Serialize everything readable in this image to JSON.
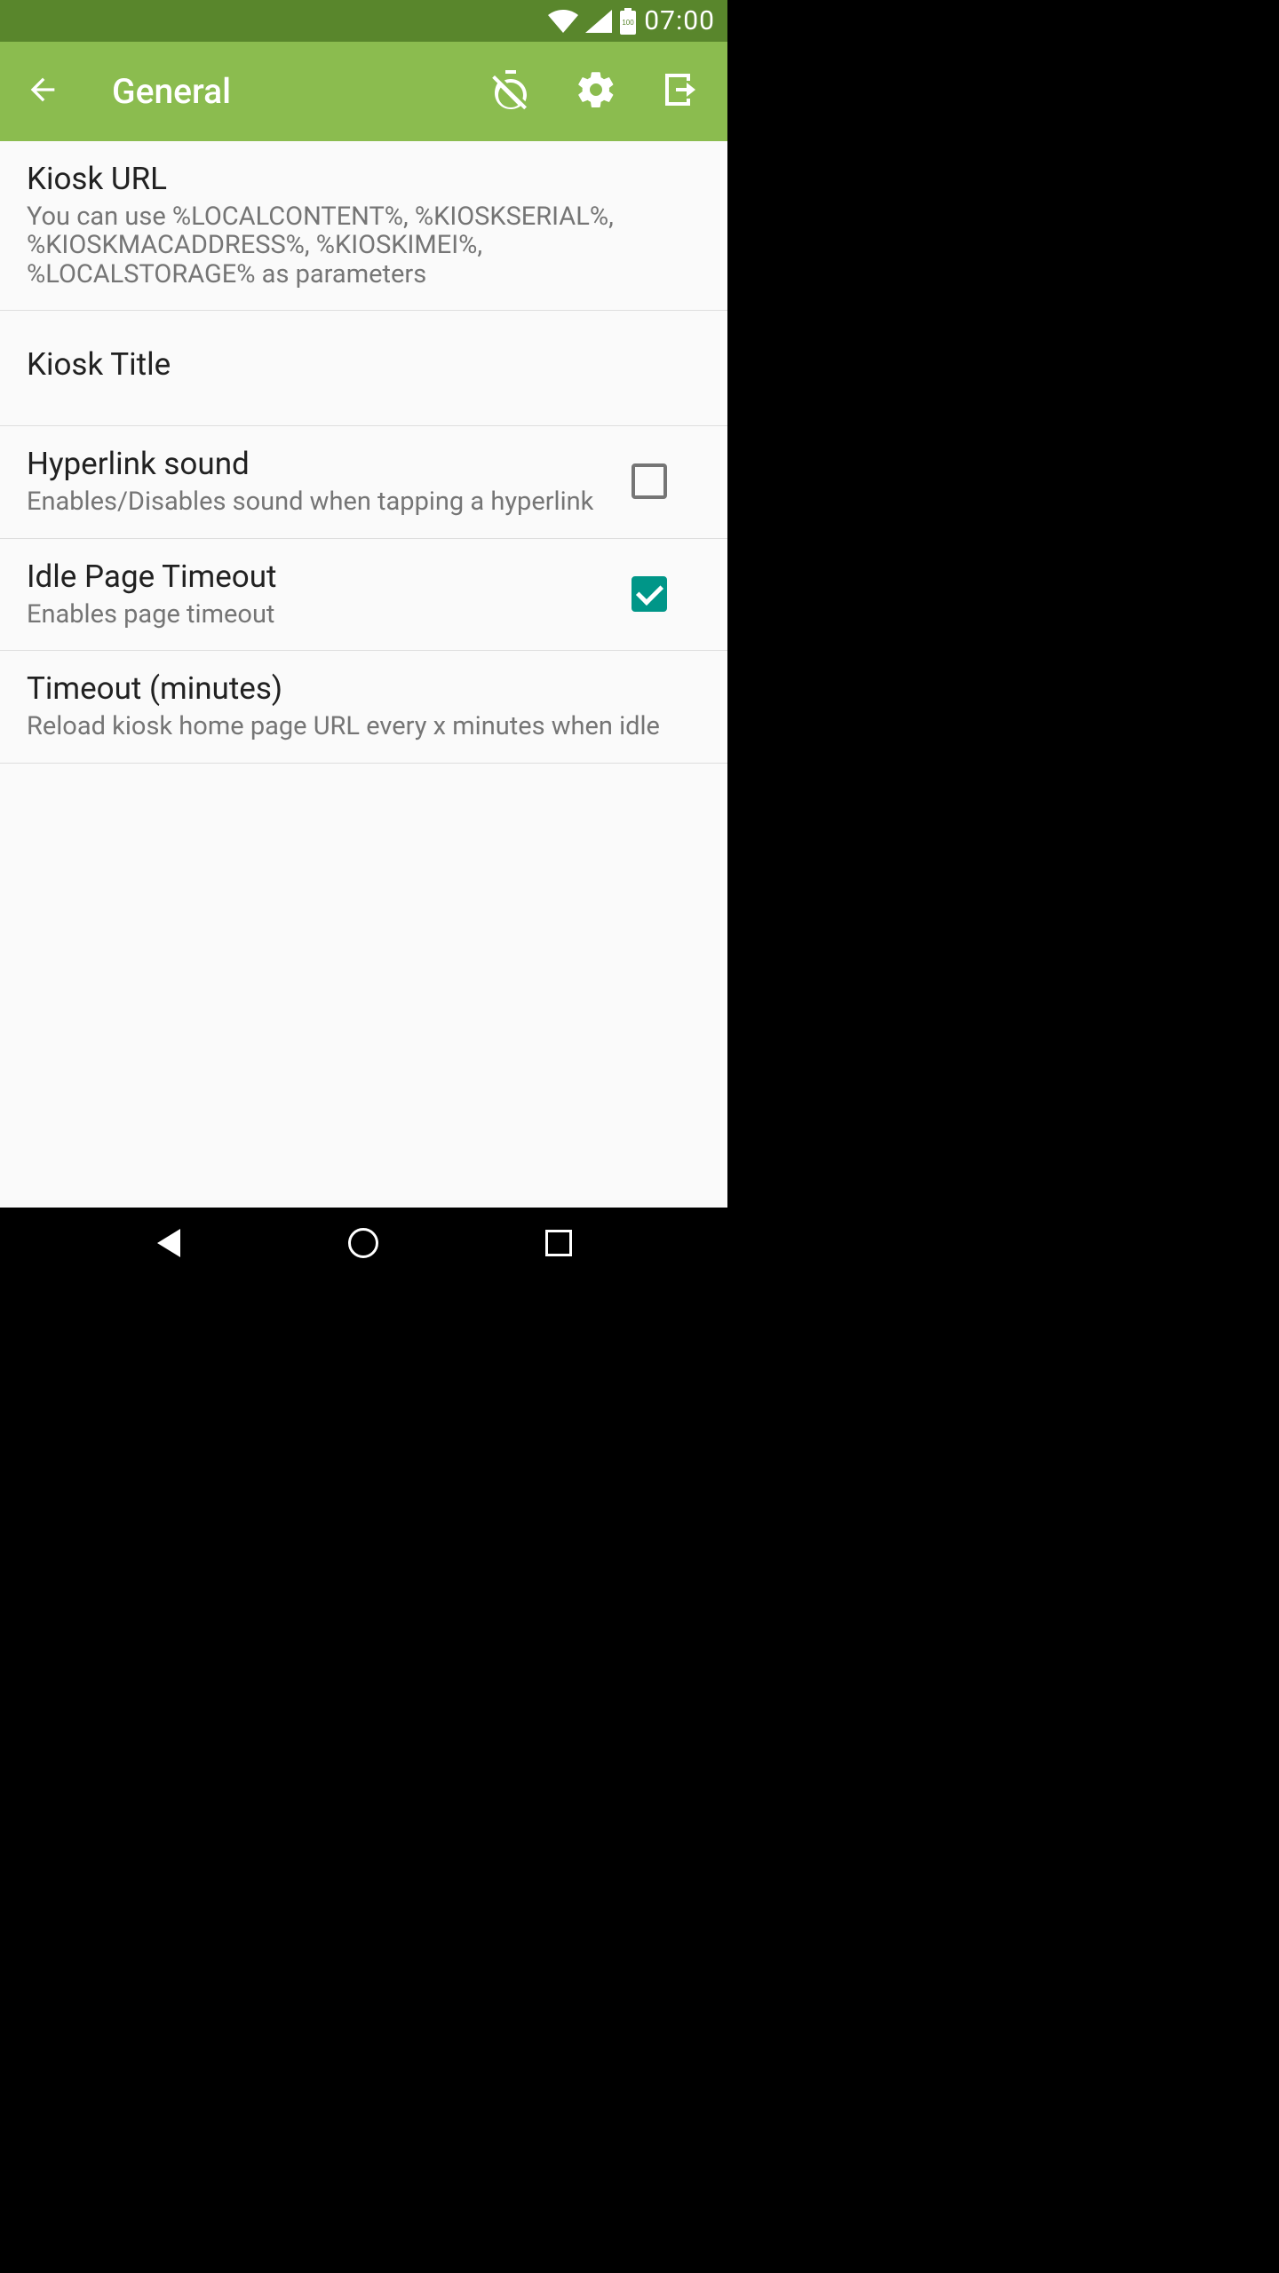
{
  "status": {
    "time": "07:00",
    "battery_label": "100"
  },
  "header": {
    "title": "General"
  },
  "settings": {
    "kiosk_url": {
      "title": "Kiosk URL",
      "sub": "You can use %LOCALCONTENT%, %KIOSKSERIAL%, %KIOSKMACADDRESS%, %KIOSKIMEI%, %LOCALSTORAGE% as parameters"
    },
    "kiosk_title": {
      "title": "Kiosk Title"
    },
    "hyperlink_sound": {
      "title": "Hyperlink sound",
      "sub": "Enables/Disables sound when tapping a hyperlink",
      "checked": false
    },
    "idle_page_timeout": {
      "title": "Idle Page Timeout",
      "sub": "Enables page timeout",
      "checked": true
    },
    "timeout_minutes": {
      "title": "Timeout (minutes)",
      "sub": "Reload kiosk home page URL every x minutes when idle"
    }
  }
}
